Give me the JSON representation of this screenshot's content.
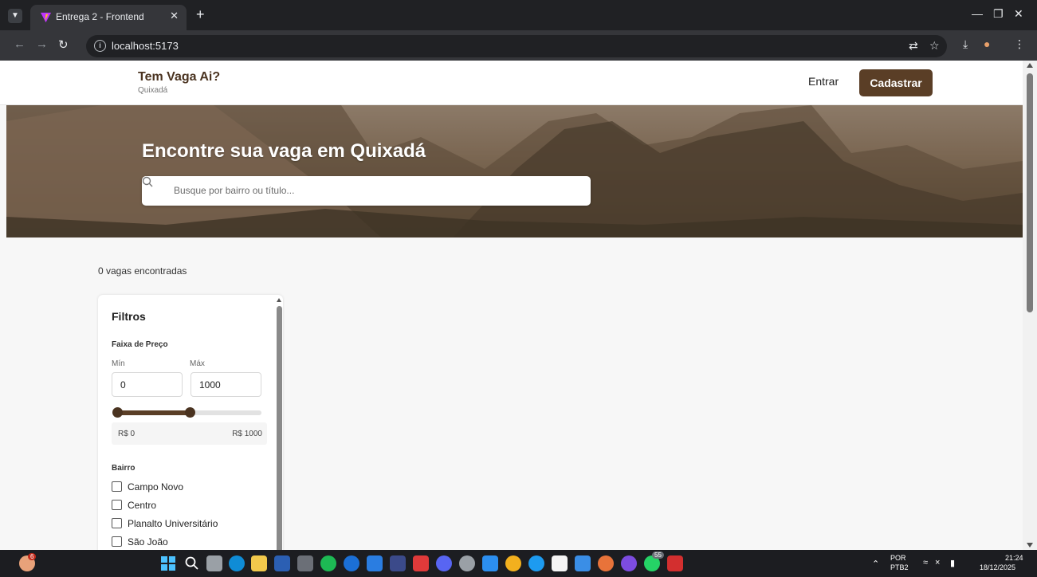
{
  "browser": {
    "tab_title": "Entrega 2 - Frontend",
    "url": "localhost:5173",
    "icons": [
      "chevron-down-icon",
      "close-icon",
      "plus-icon",
      "back-icon",
      "forward-icon",
      "reload-icon",
      "info-icon",
      "translate-icon",
      "star-icon",
      "download-icon",
      "extension-icon",
      "more-icon",
      "minimize-icon",
      "restore-icon"
    ]
  },
  "header": {
    "brand_title": "Tem Vaga Ai?",
    "brand_subtitle": "Quixadá",
    "login_label": "Entrar",
    "signup_label": "Cadastrar"
  },
  "hero": {
    "title": "Encontre sua vaga em Quixadá",
    "search_placeholder": "Busque por bairro ou título..."
  },
  "results": {
    "count_text": "0 vagas encontradas"
  },
  "filters": {
    "title": "Filtros",
    "price_heading": "Faixa de Preço",
    "min_label": "Mín",
    "max_label": "Máx",
    "min_value": "0",
    "max_value": "1000",
    "slider": {
      "min": 0,
      "max": 2000,
      "low": 0,
      "high": 1000
    },
    "range_min_text": "R$ 0",
    "range_max_text": "R$ 1000",
    "bairro_heading": "Bairro",
    "bairros": [
      {
        "label": "Campo Novo"
      },
      {
        "label": "Centro"
      },
      {
        "label": "Planalto Universitário"
      },
      {
        "label": "São João"
      }
    ]
  },
  "taskbar": {
    "notification_badge": "6",
    "whatsapp_badge": "55",
    "language_top": "POR",
    "language_bottom": "PTB2",
    "time": "21:24",
    "date": "18/12/2025"
  },
  "colors": {
    "brand": "#5a3e26",
    "brand_dark": "#4a3320",
    "page_bg": "#f7f7f7"
  }
}
